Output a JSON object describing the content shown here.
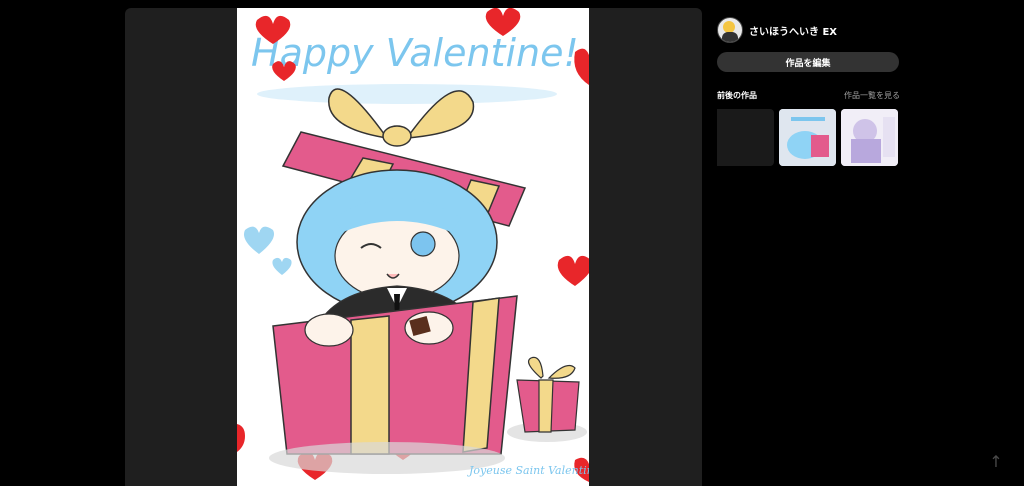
{
  "user": {
    "name": "さいほうへいき EX"
  },
  "buttons": {
    "edit": "作品を編集"
  },
  "related": {
    "title": "前後の作品",
    "link": "作品一覧を見る"
  },
  "artwork": {
    "title_text": "Happy Valentine!",
    "signature_text": "Joyeuse Saint Valentin"
  },
  "icons": {
    "scroll_top": "arrow-up-icon"
  },
  "colors": {
    "background": "#000000",
    "panel": "#1f1f1f",
    "button": "#333333",
    "accent_heart": "#e8262a",
    "gift_pink": "#e35b8c",
    "ribbon": "#f3d98b"
  }
}
